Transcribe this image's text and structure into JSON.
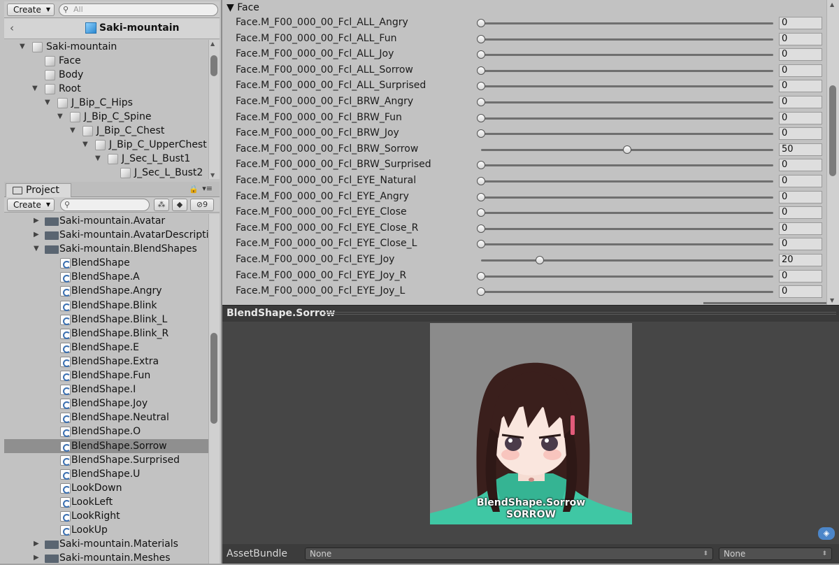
{
  "hierarchy": {
    "create_label": "Create",
    "search_placeholder": "All",
    "header_title": "Saki-mountain",
    "items": [
      {
        "label": "Saki-mountain",
        "depth": 0,
        "expanded": true
      },
      {
        "label": "Face",
        "depth": 1,
        "expanded": null
      },
      {
        "label": "Body",
        "depth": 1,
        "expanded": null
      },
      {
        "label": "Root",
        "depth": 1,
        "expanded": true
      },
      {
        "label": "J_Bip_C_Hips",
        "depth": 2,
        "expanded": true
      },
      {
        "label": "J_Bip_C_Spine",
        "depth": 3,
        "expanded": true
      },
      {
        "label": "J_Bip_C_Chest",
        "depth": 4,
        "expanded": true
      },
      {
        "label": "J_Bip_C_UpperChest",
        "depth": 5,
        "expanded": true
      },
      {
        "label": "J_Sec_L_Bust1",
        "depth": 6,
        "expanded": true
      },
      {
        "label": "J_Sec_L_Bust2",
        "depth": 7,
        "expanded": null
      }
    ]
  },
  "project": {
    "tab_label": "Project",
    "create_label": "Create",
    "hidden_count": "9",
    "folders_top": [
      {
        "label": "Saki-mountain.Avatar",
        "expanded": false
      },
      {
        "label": "Saki-mountain.AvatarDescriptio",
        "expanded": false
      },
      {
        "label": "Saki-mountain.BlendShapes",
        "expanded": true
      }
    ],
    "assets": [
      "BlendShape",
      "BlendShape.A",
      "BlendShape.Angry",
      "BlendShape.Blink",
      "BlendShape.Blink_L",
      "BlendShape.Blink_R",
      "BlendShape.E",
      "BlendShape.Extra",
      "BlendShape.Fun",
      "BlendShape.I",
      "BlendShape.Joy",
      "BlendShape.Neutral",
      "BlendShape.O",
      "BlendShape.Sorrow",
      "BlendShape.Surprised",
      "BlendShape.U",
      "LookDown",
      "LookLeft",
      "LookRight",
      "LookUp"
    ],
    "selected_asset": "BlendShape.Sorrow",
    "folders_bottom": [
      {
        "label": "Saki-mountain.Materials",
        "expanded": false
      },
      {
        "label": "Saki-mountain.Meshes",
        "expanded": false
      }
    ]
  },
  "inspector": {
    "section_title": "Face",
    "slider_max": 100,
    "shapes": [
      {
        "name": "Face.M_F00_000_00_Fcl_ALL_Angry",
        "value": "0"
      },
      {
        "name": "Face.M_F00_000_00_Fcl_ALL_Fun",
        "value": "0"
      },
      {
        "name": "Face.M_F00_000_00_Fcl_ALL_Joy",
        "value": "0"
      },
      {
        "name": "Face.M_F00_000_00_Fcl_ALL_Sorrow",
        "value": "0"
      },
      {
        "name": "Face.M_F00_000_00_Fcl_ALL_Surprised",
        "value": "0"
      },
      {
        "name": "Face.M_F00_000_00_Fcl_BRW_Angry",
        "value": "0"
      },
      {
        "name": "Face.M_F00_000_00_Fcl_BRW_Fun",
        "value": "0"
      },
      {
        "name": "Face.M_F00_000_00_Fcl_BRW_Joy",
        "value": "0"
      },
      {
        "name": "Face.M_F00_000_00_Fcl_BRW_Sorrow",
        "value": "50"
      },
      {
        "name": "Face.M_F00_000_00_Fcl_BRW_Surprised",
        "value": "0"
      },
      {
        "name": "Face.M_F00_000_00_Fcl_EYE_Natural",
        "value": "0"
      },
      {
        "name": "Face.M_F00_000_00_Fcl_EYE_Angry",
        "value": "0"
      },
      {
        "name": "Face.M_F00_000_00_Fcl_EYE_Close",
        "value": "0"
      },
      {
        "name": "Face.M_F00_000_00_Fcl_EYE_Close_R",
        "value": "0"
      },
      {
        "name": "Face.M_F00_000_00_Fcl_EYE_Close_L",
        "value": "0"
      },
      {
        "name": "Face.M_F00_000_00_Fcl_EYE_Joy",
        "value": "20"
      },
      {
        "name": "Face.M_F00_000_00_Fcl_EYE_Joy_R",
        "value": "0"
      },
      {
        "name": "Face.M_F00_000_00_Fcl_EYE_Joy_L",
        "value": "0"
      }
    ]
  },
  "preview": {
    "title": "BlendShape.Sorrow",
    "caption_line1": "BlendShape.Sorrow",
    "caption_line2": "SORROW"
  },
  "asset_bundle": {
    "label": "AssetBundle",
    "name_value": "None",
    "variant_value": "None"
  },
  "colors": {
    "selected_row": "#8f8f8f",
    "hair": "#3a1f1c",
    "jacket": "#3fc7a4",
    "preview_bg": "#464646"
  }
}
